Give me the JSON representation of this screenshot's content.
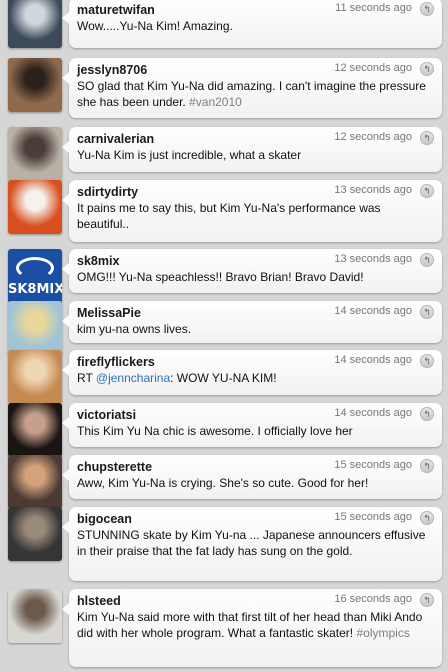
{
  "tweets": [
    {
      "user": "maturetwifan",
      "time": "11 seconds ago",
      "parts": [
        {
          "t": "Wow.....Yu-Na Kim!  Amazing."
        }
      ],
      "avatar": {
        "bg": "#3c4a5a",
        "accent": "#cfd6dc"
      }
    },
    {
      "user": "jesslyn8706",
      "time": "12 seconds ago",
      "parts": [
        {
          "t": "SO glad that Kim Yu-Na did amazing. I can't imagine the pressure she has been under. "
        },
        {
          "t": "#van2010",
          "k": "tag"
        }
      ],
      "avatar": {
        "bg": "#8f6a4c",
        "accent": "#2b211b"
      }
    },
    {
      "user": "carnivalerian",
      "time": "12 seconds ago",
      "parts": [
        {
          "t": "Yu-Na Kim is just incredible, what a skater"
        }
      ],
      "avatar": {
        "bg": "#b9b1a6",
        "accent": "#4a3e38"
      }
    },
    {
      "user": "sdirtydirty",
      "time": "13 seconds ago",
      "parts": [
        {
          "t": "It pains me to say this, but Kim Yu-Na's performance was beautiful.."
        }
      ],
      "avatar": {
        "bg": "#d9501f",
        "accent": "#f4f1ee"
      }
    },
    {
      "user": "sk8mix",
      "time": "13 seconds ago",
      "parts": [
        {
          "t": "OMG!!! Yu-Na speachless!! Bravo Brian! Bravo David!"
        }
      ],
      "avatar": {
        "bg": "#1b4fa3",
        "accent": "#ffffff"
      },
      "logo_text": "SK8MIX"
    },
    {
      "user": "MelissaPie",
      "time": "14 seconds ago",
      "parts": [
        {
          "t": "kim yu-na owns lives."
        }
      ],
      "avatar": {
        "bg": "#9fc4d8",
        "accent": "#e8d69a"
      }
    },
    {
      "user": "fireflyflickers",
      "time": "14 seconds ago",
      "parts": [
        {
          "t": "RT "
        },
        {
          "t": "@jenncharina",
          "k": "mention"
        },
        {
          "t": ": WOW YU-NA KIM!"
        }
      ],
      "avatar": {
        "bg": "#c48a52",
        "accent": "#f0d7b4"
      }
    },
    {
      "user": "victoriatsi",
      "time": "14 seconds ago",
      "parts": [
        {
          "t": "This Kim Yu Na chic is awesome. I officially love her"
        }
      ],
      "avatar": {
        "bg": "#1a1412",
        "accent": "#c6a08a"
      }
    },
    {
      "user": "chupsterette",
      "time": "15 seconds ago",
      "parts": [
        {
          "t": "Aww, Kim Yu-Na is crying. She's so cute. Good for her!"
        }
      ],
      "avatar": {
        "bg": "#4c3a33",
        "accent": "#d3a27c"
      }
    },
    {
      "user": "bigocean",
      "time": "15 seconds ago",
      "parts": [
        {
          "t": "STUNNING skate by Kim Yu-na ... Japanese announcers effusive in their praise that the fat lady has sung on the gold."
        }
      ],
      "avatar": {
        "bg": "#353535",
        "accent": "#9a8a7c"
      }
    },
    {
      "user": "hlsteed",
      "time": "16 seconds ago",
      "parts": [
        {
          "t": "Kim Yu-Na said more with that first tilt of her head than Miki Ando did with her whole program. What a fantastic skater! "
        },
        {
          "t": "#olympics",
          "k": "tag"
        }
      ],
      "avatar": {
        "bg": "#d9d7d2",
        "accent": "#6b5a4c"
      }
    }
  ],
  "reply_glyph": "↰"
}
